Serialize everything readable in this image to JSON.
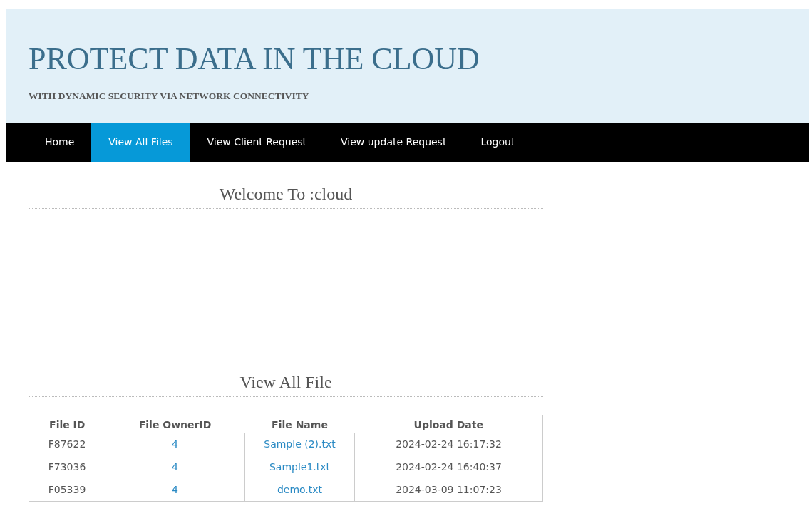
{
  "header": {
    "title": "PROTECT DATA IN THE CLOUD",
    "subtitle": "WITH DYNAMIC SECURITY VIA NETWORK CONNECTIVITY"
  },
  "nav": [
    {
      "label": "Home",
      "selected": false
    },
    {
      "label": "View All Files",
      "selected": true
    },
    {
      "label": "View Client Request",
      "selected": false
    },
    {
      "label": "View update Request",
      "selected": false
    },
    {
      "label": "Logout",
      "selected": false
    }
  ],
  "welcome": {
    "heading": "Welcome To :cloud"
  },
  "files": {
    "heading": "View All File",
    "table": {
      "columns": [
        "File ID",
        "File OwnerID",
        "File Name",
        "Upload Date"
      ],
      "rows": [
        {
          "file_id": "F87622",
          "owner_id": "4",
          "file_name": "Sample (2).txt",
          "upload_date": "2024-02-24 16:17:32"
        },
        {
          "file_id": "F73036",
          "owner_id": "4",
          "file_name": "Sample1.txt",
          "upload_date": "2024-02-24 16:40:37"
        },
        {
          "file_id": "F05339",
          "owner_id": "4",
          "file_name": "demo.txt",
          "upload_date": "2024-03-09 11:07:23"
        }
      ]
    }
  }
}
